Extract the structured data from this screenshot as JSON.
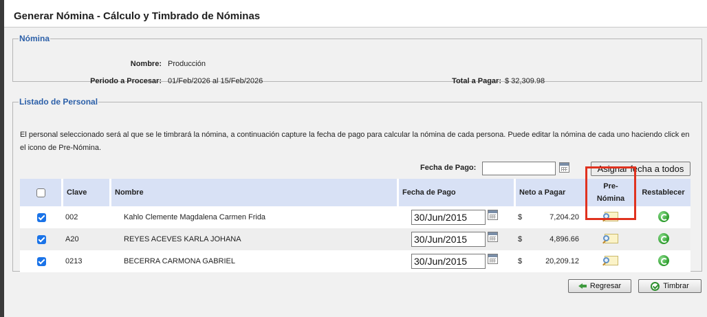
{
  "page": {
    "title": "Generar Nómina - Cálculo y Timbrado de Nóminas"
  },
  "nomina": {
    "legend": "Nómina",
    "nombre_label": "Nombre:",
    "nombre_value": "Producción",
    "periodo_label": "Periodo a Procesar:",
    "periodo_value": "01/Feb/2026 al 15/Feb/2026",
    "total_label": "Total a Pagar:",
    "total_value": "$ 32,309.98"
  },
  "listado": {
    "legend": "Listado de Personal",
    "description": "El personal seleccionado será al que se le timbrará la nómina, a continuación capture la fecha de pago para calcular la nómina de cada persona. Puede editar la nómina de cada uno haciendo click en el icono de Pre-Nómina.",
    "fecha_pago_label": "Fecha de Pago:",
    "fecha_pago_value": "",
    "assign_all_label": "Asignar fecha a todos",
    "columns": {
      "clave": "Clave",
      "nombre": "Nombre",
      "fecha_pago": "Fecha de Pago",
      "neto": "Neto a Pagar",
      "pre_nomina_1": "Pre-",
      "pre_nomina_2": "Nómina",
      "restablecer": "Restablecer"
    },
    "rows": [
      {
        "checked": true,
        "clave": "002",
        "nombre": "Kahlo Clemente Magdalena Carmen Frida",
        "fecha": "30/Jun/2015",
        "currency": "$",
        "neto": "7,204.20"
      },
      {
        "checked": true,
        "clave": "A20",
        "nombre": "REYES ACEVES KARLA JOHANA",
        "fecha": "30/Jun/2015",
        "currency": "$",
        "neto": "4,896.66"
      },
      {
        "checked": true,
        "clave": "0213",
        "nombre": "BECERRA CARMONA GABRIEL",
        "fecha": "30/Jun/2015",
        "currency": "$",
        "neto": "20,209.12"
      }
    ]
  },
  "footer": {
    "regresar_label": "Regresar",
    "timbrar_label": "Timbrar"
  },
  "colors": {
    "accent": "#2b5fa8",
    "header_bg": "#d8e1f5",
    "highlight": "#e0321f",
    "checkbox": "#1a73e8"
  },
  "icons": [
    "calendar-icon",
    "pre-nomina-icon",
    "restablecer-icon",
    "back-arrow-icon",
    "check-circle-icon"
  ]
}
